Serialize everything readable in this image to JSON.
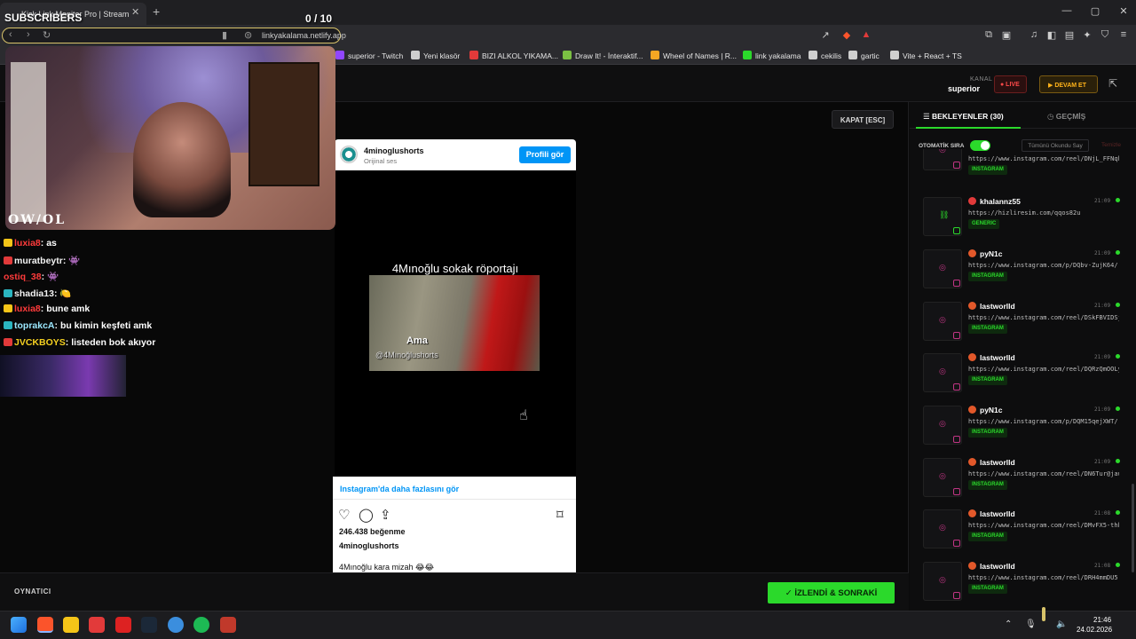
{
  "browser": {
    "tab_title": "Kick Link Monitor Pro | Stream",
    "url": "linkyakalama.netlify.app",
    "bookmarks": [
      {
        "label": "superior - Twitch",
        "color": "#9146ff"
      },
      {
        "label": "Yeni klasör",
        "color": "#cfcfcf"
      },
      {
        "label": "BIZI ALKOL YIKAMA...",
        "color": "#e23a3a"
      },
      {
        "label": "Draw It! - İnteraktif...",
        "color": "#7bc043"
      },
      {
        "label": "Wheel of Names | R...",
        "color": "#f5a623"
      },
      {
        "label": "link yakalama",
        "color": "#2bd92b"
      },
      {
        "label": "cekilis",
        "color": "#cfcfcf"
      },
      {
        "label": "gartic",
        "color": "#cfcfcf"
      },
      {
        "label": "Vite + React + TS",
        "color": "#cfcfcf"
      }
    ]
  },
  "overlay": {
    "subs_title": "SUBSCRIBERS",
    "subs_count": "0  / 10",
    "cam_label": "OW/OL"
  },
  "chat": [
    {
      "user": "luxia8",
      "user_color": "#ff3b3b",
      "badge": "#f5c518",
      "msg": "as"
    },
    {
      "user": "muratbeytr",
      "user_color": "#f2f2f2",
      "badge": "#e23a3a",
      "msg": "👾"
    },
    {
      "user": "ostiq_38",
      "user_color": "#ff3b3b",
      "badge": "",
      "msg": "👾"
    },
    {
      "user": "shadia13",
      "user_color": "#f2f2f2",
      "badge": "#2bb5c0",
      "msg": "🍋"
    },
    {
      "user": "luxia8",
      "user_color": "#ff3b3b",
      "badge": "#f5c518",
      "msg": "bune amk"
    },
    {
      "user": "toprakcA",
      "user_color": "#9be8ff",
      "badge": "#2bb5c0",
      "msg": "bu kimin keşfeti amk"
    },
    {
      "user": "JVCKBOYS",
      "user_color": "#f5d020",
      "badge": "#e23a3a",
      "msg": "listeden bok akıyor"
    }
  ],
  "header": {
    "kanal_label": "KANAL",
    "kanal_value": "superior",
    "live_label": "● LIVE",
    "devam_label": "▶  DEVAM ET"
  },
  "player": {
    "close_label": "KAPAT [ESC]",
    "footer_label": "OYNATICI",
    "watched_label": "✓  İZLENDİ & SONRAKİ"
  },
  "instagram": {
    "username": "4minoglushorts",
    "audio": "Orijinal ses",
    "profile_button": "Profili gör",
    "video_title": "4Mınoğlu  sokak röportajı",
    "frame_text": "Ama",
    "watermark": "@4Mınoğlushorts",
    "more_link": "Instagram'da daha fazlasını gör",
    "likes": "246.438 beğenme",
    "caption_user": "4minoglushorts",
    "caption": "4Mınoğlu kara mizah 😂😂"
  },
  "queue": {
    "tab_waiting": "BEKLEYENLER (30)",
    "tab_history": "GEÇMİŞ",
    "auto_label": "OTOMATİK SIRA",
    "mark_all_label": "Tümünü Okundu Say",
    "clear_label": "Temizle",
    "items": [
      {
        "user": "",
        "dot_color": "",
        "url": "https://www.instagram.com/reel/DNjL_FFNqh...",
        "time": "",
        "tag": "INSTAGRAM"
      },
      {
        "user": "khalannz55",
        "dot_color": "#e23a3a",
        "url": "https://hizliresim.com/qqos82u",
        "time": "21:09",
        "tag": "GENERIC"
      },
      {
        "user": "pyN1c",
        "dot_color": "#e2582a",
        "url": "https://www.instagram.com/p/DQbv-ZujK64/",
        "time": "21:09",
        "tag": "INSTAGRAM"
      },
      {
        "user": "lastworlld",
        "dot_color": "#e2582a",
        "url": "https://www.instagram.com/reel/DSkFBVIDSj...",
        "time": "21:09",
        "tag": "INSTAGRAM"
      },
      {
        "user": "lastworlld",
        "dot_color": "#e2582a",
        "url": "https://www.instagram.com/reel/DQRzQmOOLy...",
        "time": "21:09",
        "tag": "INSTAGRAM"
      },
      {
        "user": "pyN1c",
        "dot_color": "#e2582a",
        "url": "https://www.instagram.com/p/DQM15qejXWT/",
        "time": "21:09",
        "tag": "INSTAGRAM"
      },
      {
        "user": "lastworlld",
        "dot_color": "#e2582a",
        "url": "https://www.instagram.com/reel/DN6Tur@jau...",
        "time": "21:09",
        "tag": "INSTAGRAM"
      },
      {
        "user": "lastworlld",
        "dot_color": "#e2582a",
        "url": "https://www.instagram.com/reel/DMvFX5-thb...",
        "time": "21:08",
        "tag": "INSTAGRAM"
      },
      {
        "user": "lastworlld",
        "dot_color": "#e2582a",
        "url": "https://www.instagram.com/reel/DRH4mmDU5...",
        "time": "21:08",
        "tag": "INSTAGRAM"
      }
    ]
  },
  "taskbar": {
    "time": "21:46",
    "date": "24.02.2026",
    "apps": [
      {
        "name": "windows-start",
        "color": "#1e90ff"
      },
      {
        "name": "brave",
        "color": "#fb542b"
      },
      {
        "name": "file-explorer",
        "color": "#f5c518"
      },
      {
        "name": "maps-pin",
        "color": "#e23a3a"
      },
      {
        "name": "recorder",
        "color": "#d22"
      },
      {
        "name": "steam",
        "color": "#1b2838"
      },
      {
        "name": "browser",
        "color": "#3b8ede"
      },
      {
        "name": "spotify",
        "color": "#1db954"
      },
      {
        "name": "streamer-app",
        "color": "#c0392b"
      }
    ]
  }
}
